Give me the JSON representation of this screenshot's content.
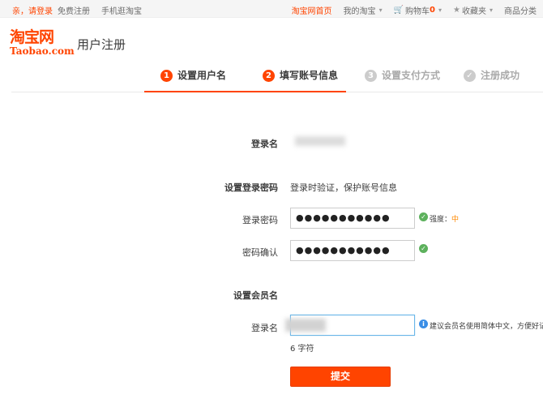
{
  "topbar": {
    "login_prompt": "亲，请登录",
    "free_register": "免费注册",
    "mobile": "手机逛淘宝",
    "home": "淘宝网首页",
    "my_taobao": "我的淘宝",
    "cart_label": "购物车",
    "cart_count": "0",
    "favorites": "收藏夹",
    "categories": "商品分类"
  },
  "header": {
    "logo_cn": "淘宝网",
    "logo_en": "Taobao.com",
    "title": "用户注册"
  },
  "steps": [
    {
      "num": "1",
      "label": "设置用户名",
      "state": "active"
    },
    {
      "num": "2",
      "label": "填写账号信息",
      "state": "active"
    },
    {
      "num": "3",
      "label": "设置支付方式",
      "state": "inactive"
    },
    {
      "num": "✓",
      "label": "注册成功",
      "state": "inactive"
    }
  ],
  "form": {
    "login_name_label": "登录名",
    "password_section_label": "设置登录密码",
    "password_section_desc": "登录时验证，保护账号信息",
    "password_label": "登录密码",
    "password_value": "●●●●●●●●●●●",
    "strength_prefix": "强度：",
    "strength_value": "中",
    "confirm_label": "密码确认",
    "confirm_value": "●●●●●●●●●●●",
    "member_section_label": "设置会员名",
    "member_login_label": "登录名",
    "member_hint": "建议会员名使用简体中文，方便好记",
    "char_count": "6 字符",
    "submit_label": "提交"
  },
  "colors": {
    "brand": "#ff4400",
    "ok": "#5db15d",
    "info": "#3a8ee6"
  }
}
